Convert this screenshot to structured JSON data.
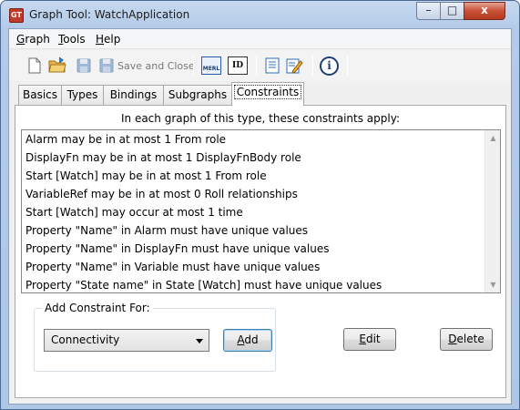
{
  "window": {
    "title": "Graph Tool: WatchApplication",
    "icon": "graph-tool-app-icon",
    "controls": {
      "minimize": "–",
      "maximize": "□",
      "close": "x"
    }
  },
  "menubar": {
    "items": [
      {
        "label": "Graph",
        "mnemonic": "G",
        "rest": "raph"
      },
      {
        "label": "Tools",
        "mnemonic": "T",
        "rest": "ools"
      },
      {
        "label": "Help",
        "mnemonic": "H",
        "rest": "elp"
      }
    ]
  },
  "toolbar": {
    "save_and_close_label": "Save and Close",
    "meml_label": "MERL",
    "id_label": "ID",
    "info_label": "i"
  },
  "tabs": [
    {
      "label": "Basics"
    },
    {
      "label": "Types"
    },
    {
      "label": "Bindings"
    },
    {
      "label": "Subgraphs"
    },
    {
      "label": "Constraints",
      "active": true
    }
  ],
  "constraints": {
    "hint": "In each graph of this type, these constraints apply:",
    "items": [
      "Alarm may be in at most 1 From role",
      "DisplayFn may be in at most 1 DisplayFnBody role",
      "Start [Watch] may be in at most 1 From role",
      "VariableRef may be in at most 0 Roll relationships",
      "Start [Watch] may occur at most 1 time",
      "Property \"Name\" in Alarm must have unique values",
      "Property \"Name\" in DisplayFn must have unique values",
      "Property \"Name\" in Variable must have unique values",
      "Property \"State name\" in State [Watch] must have unique values"
    ],
    "add_group_label": "Add Constraint For:",
    "selected_type": "Connectivity",
    "add_button": {
      "mnemonic": "A",
      "rest": "dd"
    },
    "edit_button": {
      "mnemonic": "E",
      "rest": "dit"
    },
    "delete_button": {
      "mnemonic": "D",
      "rest": "elete"
    }
  },
  "colors": {
    "frame": "#aec7e5",
    "close_button": "#c95036",
    "default_button_border": "#3c7fb1"
  }
}
